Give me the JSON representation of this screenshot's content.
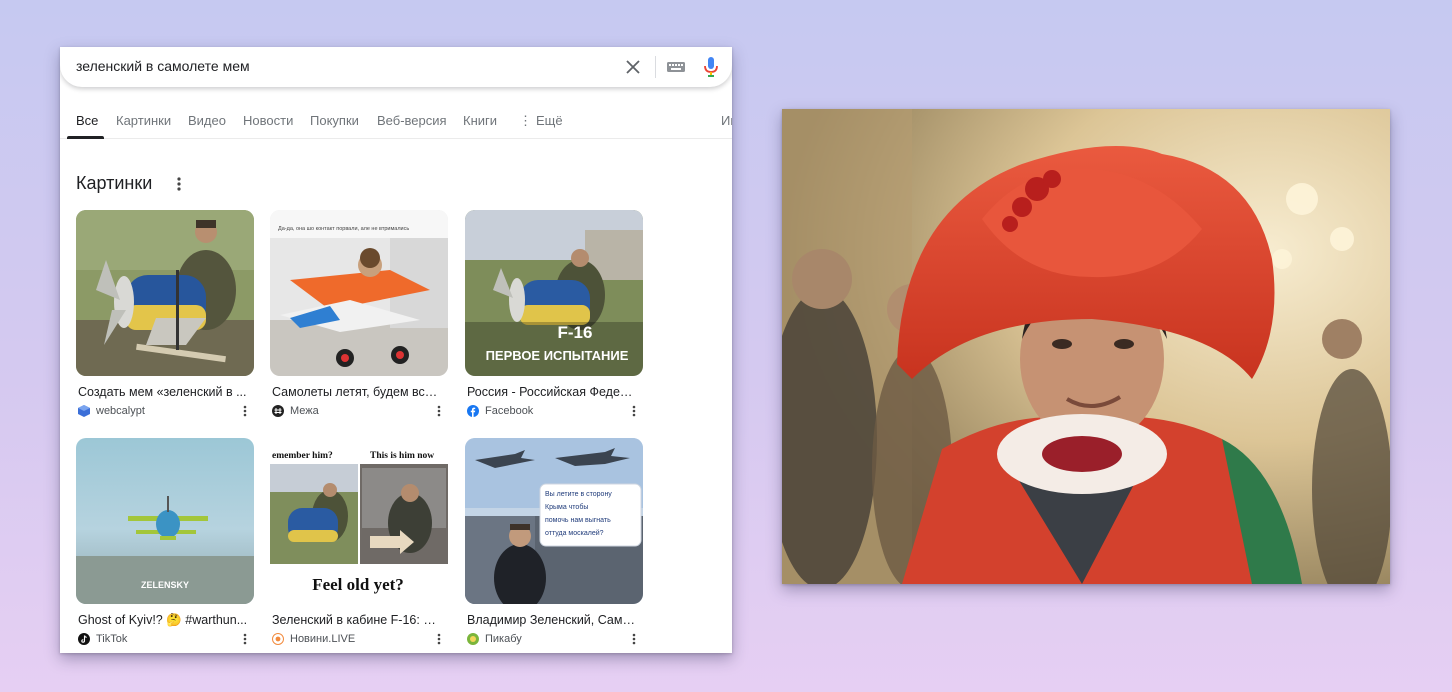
{
  "search": {
    "query": "зеленский в самолете мем"
  },
  "tabs": [
    {
      "label": "Все",
      "active": true
    },
    {
      "label": "Картинки"
    },
    {
      "label": "Видео"
    },
    {
      "label": "Новости"
    },
    {
      "label": "Покупки"
    },
    {
      "label": "Веб-версия"
    },
    {
      "label": "Книги"
    },
    {
      "label": "Ещё"
    },
    {
      "label": "Ин"
    }
  ],
  "section": {
    "title": "Картинки"
  },
  "results": [
    {
      "title": "Создать мем «зеленский в ...",
      "source": "webcalypt",
      "source_icon": "webcalypt-cube-icon",
      "icon_color": "#3b6fd8"
    },
    {
      "title": "Самолеты летят, будем все...",
      "source": "Межа",
      "source_icon": "mezha-logo-icon",
      "icon_color": "#222222"
    },
    {
      "title": "Россия - Российская Федер...",
      "source": "Facebook",
      "source_icon": "facebook-logo-icon",
      "icon_color": "#1877f2"
    },
    {
      "title": "Ghost of Kyiv!? 🤔 #warthun...",
      "source": "TikTok",
      "source_icon": "tiktok-logo-icon",
      "icon_color": "#111111"
    },
    {
      "title": "Зеленский в кабине F-16: ук...",
      "source": "Новини.LIVE",
      "source_icon": "novyny-live-logo-icon",
      "icon_color": "#f28a3c"
    },
    {
      "title": "Владимир Зеленский, Само...",
      "source": "Пикабу",
      "source_icon": "pikabu-logo-icon",
      "icon_color": "#7bb53b"
    }
  ],
  "thumb_text": {
    "r1_caption": "Да-да, она шо контакт порвали, але не втримались",
    "r3_line1": "F-16",
    "r3_line2": "ПЕРВОЕ ИСПЫТАНИЕ",
    "r4_caption": "ZELENSKY",
    "r5_left": "emember him?",
    "r5_right": "This is him now",
    "r5_bottom": "Feel old yet?",
    "r6_bubble1": "Вы летите в сторону",
    "r6_bubble2": "Крыма чтобы",
    "r6_bubble3": "помочь нам выгнать",
    "r6_bubble4": "оттуда москалей?"
  },
  "colors": {
    "accent_blue": "#4285f4",
    "mic_red": "#ea4335",
    "hat_red": "#e0442f"
  }
}
